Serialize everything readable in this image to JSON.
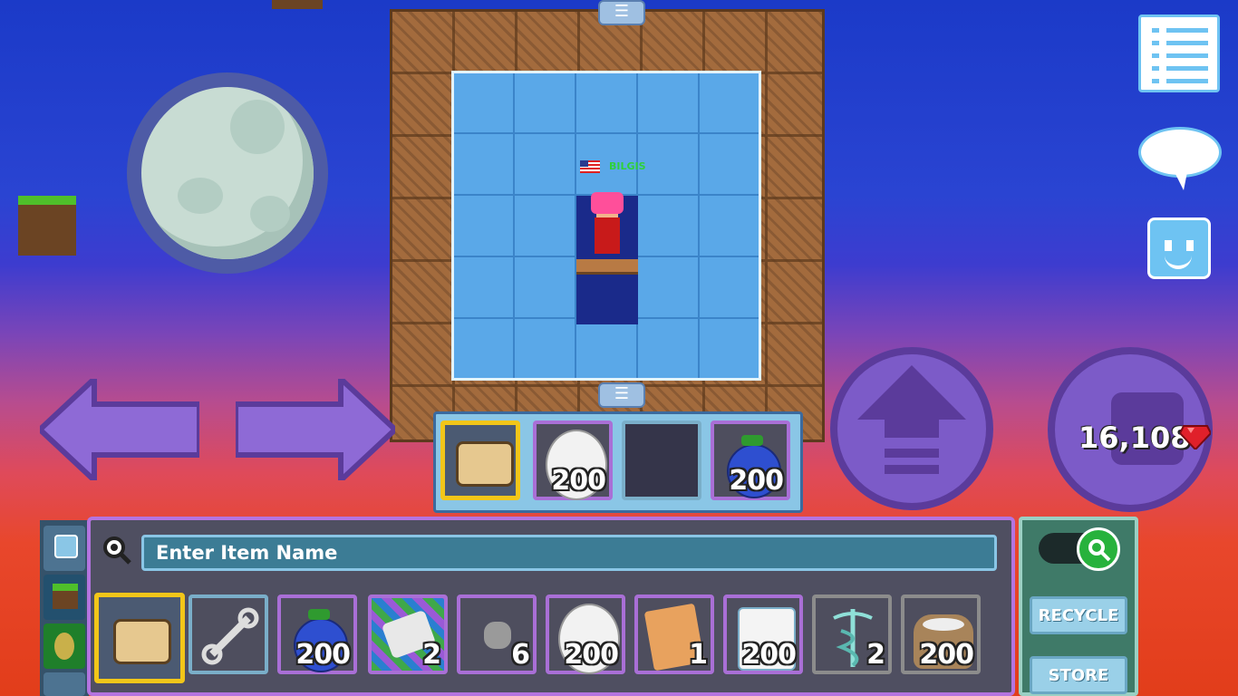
{
  "world": {
    "player": {
      "name": "BILGIS",
      "flag_icon": "us-flag-icon"
    }
  },
  "top_icons": {
    "menu_icon": "list-icon",
    "chat_icon": "speech-bubble-icon",
    "emote_icon": "smiley-icon"
  },
  "controls": {
    "left_icon": "left-arrow-icon",
    "right_icon": "right-arrow-icon",
    "jump_icon": "up-arrow-icon",
    "punch_icon": "fist-icon",
    "gems": "16,108"
  },
  "hotbar": {
    "slots": [
      {
        "item": "fist-icon",
        "qty": ""
      },
      {
        "item": "egg-icon",
        "qty": "200"
      },
      {
        "item": "",
        "qty": ""
      },
      {
        "item": "blueberry-icon",
        "qty": "200"
      }
    ]
  },
  "inventory": {
    "search_text": "Enter Item Name",
    "items": [
      {
        "item": "fist-icon",
        "qty": ""
      },
      {
        "item": "wrench-icon",
        "qty": ""
      },
      {
        "item": "blueberry-icon",
        "qty": "200"
      },
      {
        "item": "seed-pack-icon",
        "qty": "2"
      },
      {
        "item": "rock-icon",
        "qty": "6"
      },
      {
        "item": "egg-icon",
        "qty": "200"
      },
      {
        "item": "scroll-icon",
        "qty": "1"
      },
      {
        "item": "milk-carton-icon",
        "qty": "200"
      },
      {
        "item": "caduceus-icon",
        "qty": "2"
      },
      {
        "item": "flour-sack-icon",
        "qty": "200"
      }
    ],
    "recycle_label": "RECYCLE",
    "store_label": "STORE"
  },
  "colors": {
    "selected_slot": "#f2c619",
    "slot_border": "#a96fd6",
    "inventory_border": "#b474e0"
  }
}
